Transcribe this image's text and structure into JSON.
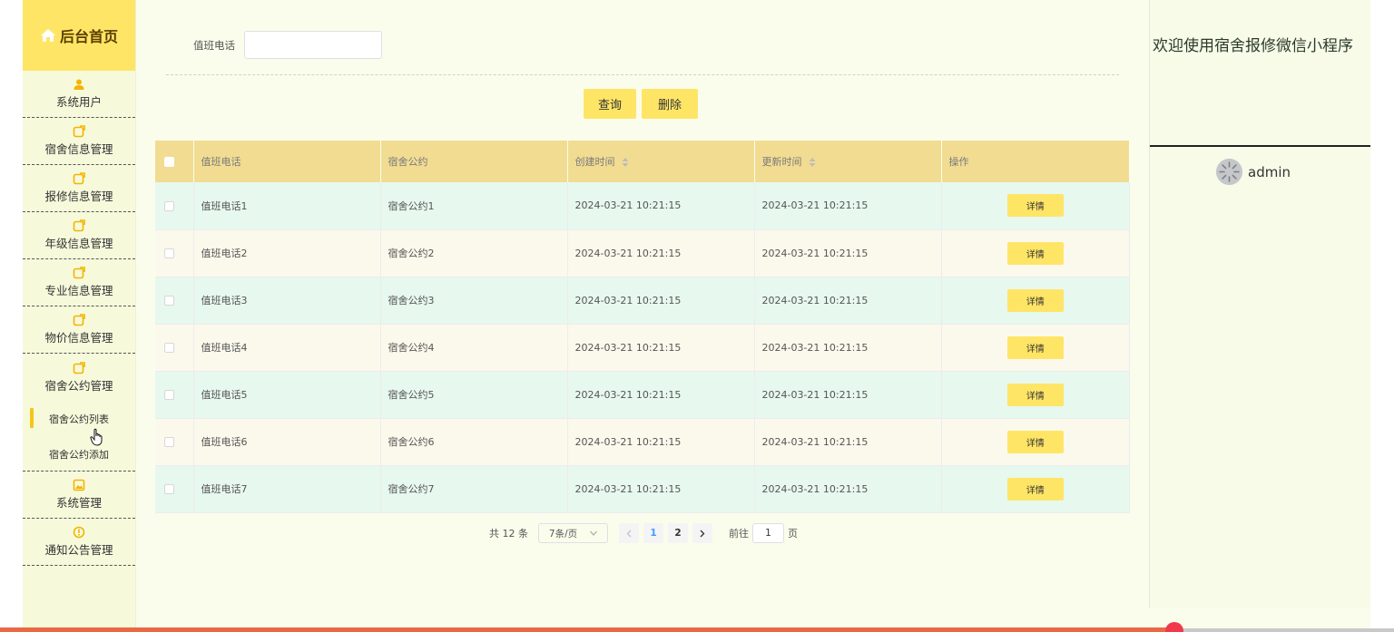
{
  "sidebar": {
    "brand": "后台首页",
    "items": [
      {
        "label": "系统用户",
        "icon": "user-icon"
      },
      {
        "label": "宿舍信息管理",
        "icon": "edit-icon"
      },
      {
        "label": "报修信息管理",
        "icon": "edit-icon"
      },
      {
        "label": "年级信息管理",
        "icon": "edit-icon"
      },
      {
        "label": "专业信息管理",
        "icon": "edit-icon"
      },
      {
        "label": "物价信息管理",
        "icon": "edit-icon"
      },
      {
        "label": "宿舍公约管理",
        "icon": "edit-icon"
      }
    ],
    "subitems": [
      {
        "label": "宿舍公约列表"
      },
      {
        "label": "宿舍公约添加"
      }
    ],
    "items_after": [
      {
        "label": "系统管理",
        "icon": "image-icon"
      },
      {
        "label": "通知公告管理",
        "icon": "info-icon"
      }
    ]
  },
  "search": {
    "label": "值班电话",
    "value": "",
    "placeholder": ""
  },
  "buttons": {
    "query": "查询",
    "delete": "删除"
  },
  "table": {
    "headers": [
      "值班电话",
      "宿舍公约",
      "创建时间",
      "更新时间",
      "操作"
    ],
    "rows": [
      {
        "phone": "值班电话1",
        "rule": "宿舍公约1",
        "created": "2024-03-21 10:21:15",
        "updated": "2024-03-21 10:21:15",
        "action": "详情"
      },
      {
        "phone": "值班电话2",
        "rule": "宿舍公约2",
        "created": "2024-03-21 10:21:15",
        "updated": "2024-03-21 10:21:15",
        "action": "详情"
      },
      {
        "phone": "值班电话3",
        "rule": "宿舍公约3",
        "created": "2024-03-21 10:21:15",
        "updated": "2024-03-21 10:21:15",
        "action": "详情"
      },
      {
        "phone": "值班电话4",
        "rule": "宿舍公约4",
        "created": "2024-03-21 10:21:15",
        "updated": "2024-03-21 10:21:15",
        "action": "详情"
      },
      {
        "phone": "值班电话5",
        "rule": "宿舍公约5",
        "created": "2024-03-21 10:21:15",
        "updated": "2024-03-21 10:21:15",
        "action": "详情"
      },
      {
        "phone": "值班电话6",
        "rule": "宿舍公约6",
        "created": "2024-03-21 10:21:15",
        "updated": "2024-03-21 10:21:15",
        "action": "详情"
      },
      {
        "phone": "值班电话7",
        "rule": "宿舍公约7",
        "created": "2024-03-21 10:21:15",
        "updated": "2024-03-21 10:21:15",
        "action": "详情"
      }
    ]
  },
  "pagination": {
    "total": "共 12 条",
    "page_size": "7条/页",
    "pages": [
      "1",
      "2"
    ],
    "current": "1",
    "goto_label": "前往",
    "goto_value": "1",
    "goto_unit": "页"
  },
  "header_right": {
    "welcome": "欢迎使用宿舍报修微信小程序",
    "username": "admin"
  },
  "colors": {
    "accent": "#ffe566",
    "table_header": "#f1dc92",
    "row_odd": "#e7f8ee",
    "row_even": "#fbf9ec",
    "sidebar_active": "#f5c518"
  }
}
